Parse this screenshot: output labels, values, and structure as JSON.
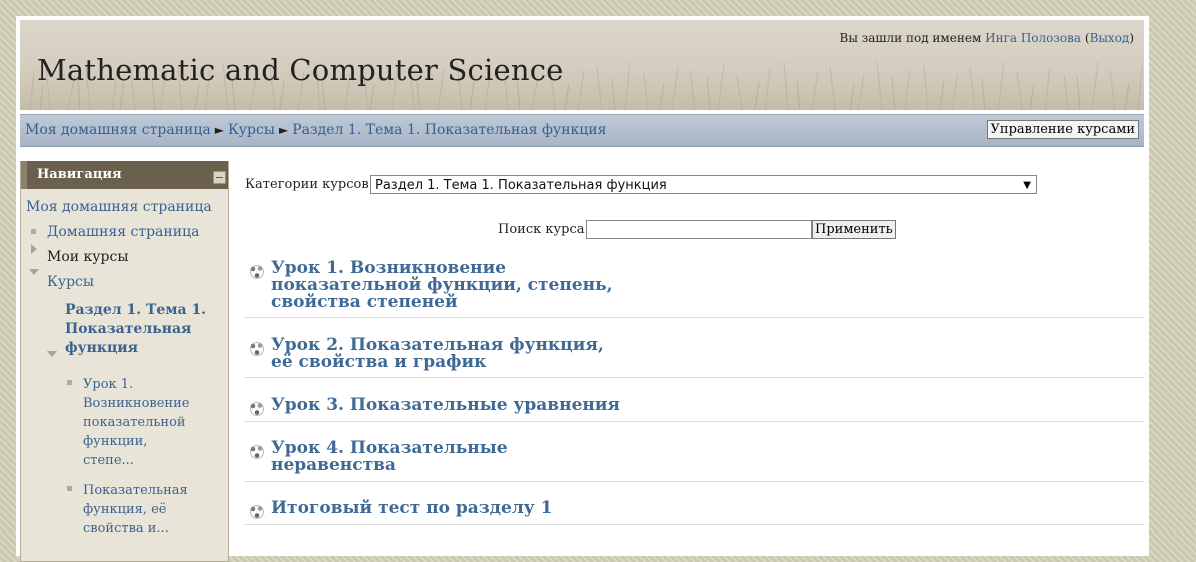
{
  "header": {
    "site_title": "Mathematic and Computer Science",
    "login_prefix": "Вы зашли под именем",
    "user_name": "Инга Полозова",
    "logout_label": "Выход"
  },
  "navbar": {
    "breadcrumbs": [
      "Моя домашняя страница",
      "Курсы",
      "Раздел 1. Тема 1. Показательная функция"
    ],
    "separator": "►",
    "manage_button": "Управление курсами"
  },
  "sidebar": {
    "title": "Навигация",
    "items": [
      {
        "label": "Моя домашняя страница"
      },
      {
        "label": "Домашняя страница"
      },
      {
        "label": "Мои курсы"
      },
      {
        "label": "Курсы"
      },
      {
        "label": "Раздел 1. Тема 1. Показательная функция"
      },
      {
        "label": "Урок 1. Возникновение показательной функции, степе..."
      },
      {
        "label": "Показательная функция, её свойства и..."
      }
    ]
  },
  "main": {
    "category_label": "Категории курсов:",
    "category_selected": "Раздел 1. Тема 1. Показательная функция",
    "search_label": "Поиск курса:",
    "search_value": "",
    "apply_label": "Применить",
    "courses": [
      {
        "title": "Урок 1. Возникновение показательной функции, степень, свойства степеней"
      },
      {
        "title": "Урок 2. Показательная функция, её свойства и график"
      },
      {
        "title": "Урок 3. Показательные уравнения"
      },
      {
        "title": "Урок 4. Показательные неравенства"
      },
      {
        "title": "Итоговый тест по разделу 1"
      }
    ]
  }
}
